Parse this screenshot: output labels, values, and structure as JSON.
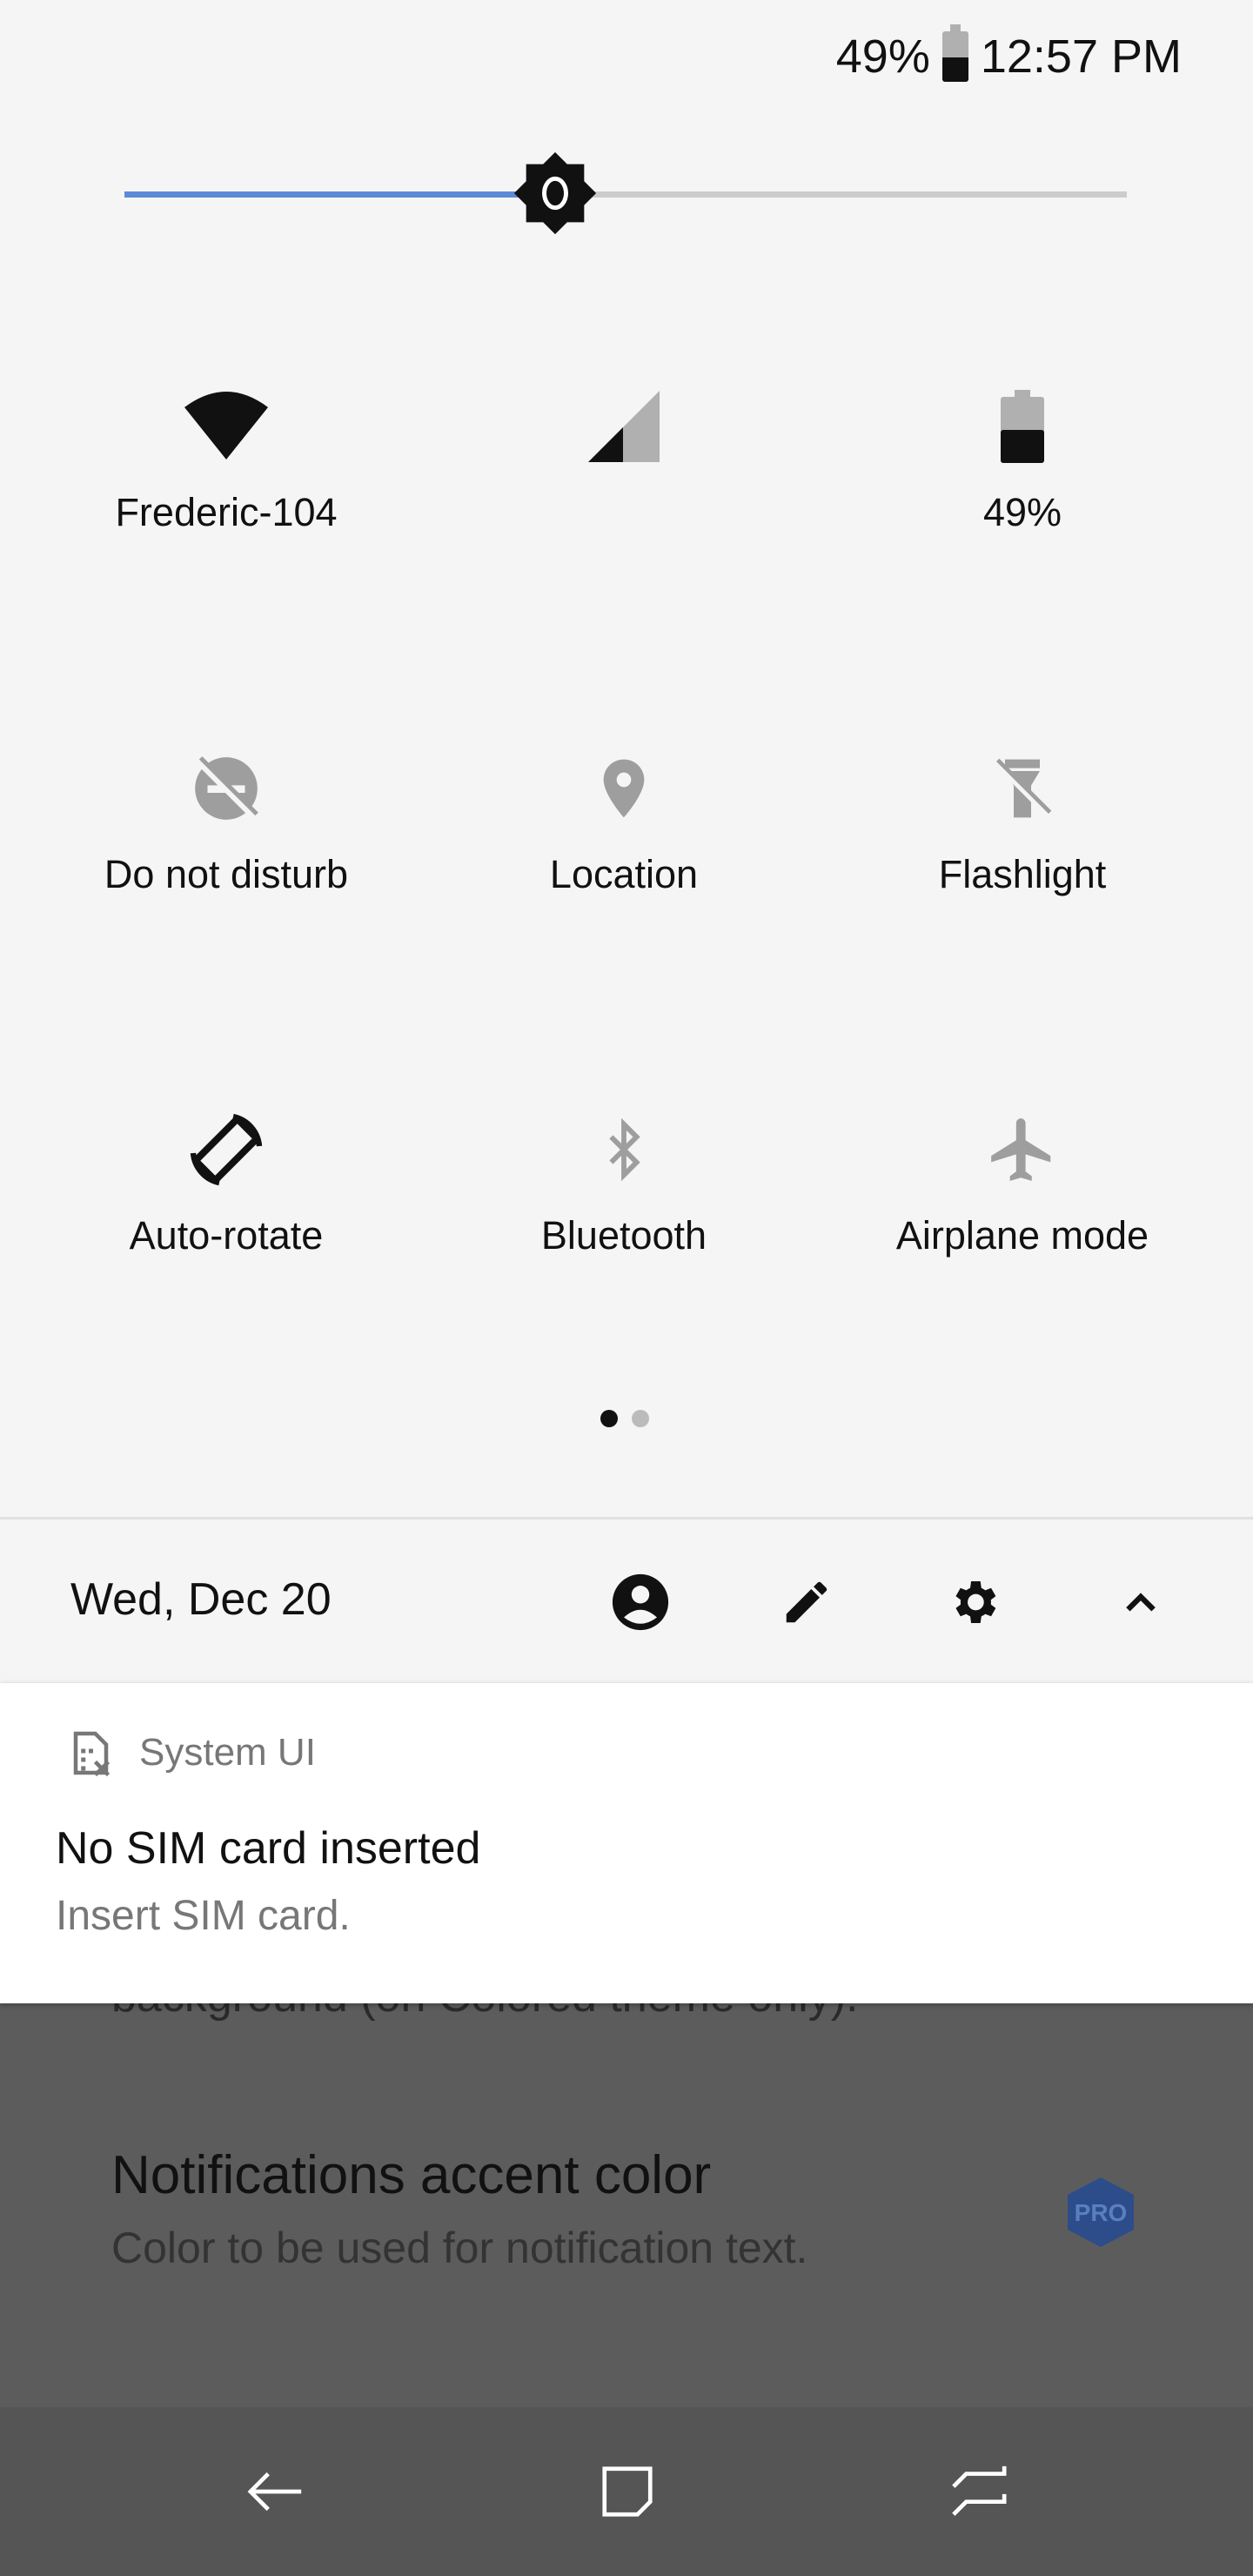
{
  "status_bar": {
    "battery_percent": "49%",
    "time": "12:57 PM",
    "battery_level": 49
  },
  "brightness": {
    "level_fraction": 0.43,
    "accent_color": "#5b8bd6"
  },
  "tiles": [
    {
      "label": "Frederic-104",
      "icon": "wifi-icon",
      "active": true
    },
    {
      "label": "",
      "icon": "cell-signal-icon",
      "active": true
    },
    {
      "label": "49%",
      "icon": "battery-icon",
      "active": true
    },
    {
      "label": "Do not disturb",
      "icon": "do-not-disturb-icon",
      "active": false
    },
    {
      "label": "Location",
      "icon": "location-icon",
      "active": false
    },
    {
      "label": "Flashlight",
      "icon": "flashlight-off-icon",
      "active": false
    },
    {
      "label": "Auto-rotate",
      "icon": "auto-rotate-icon",
      "active": true
    },
    {
      "label": "Bluetooth",
      "icon": "bluetooth-icon",
      "active": false
    },
    {
      "label": "Airplane mode",
      "icon": "airplane-icon",
      "active": false
    }
  ],
  "pager": {
    "pages": 2,
    "current": 1
  },
  "date_bar": {
    "date": "Wed, Dec 20",
    "icons": [
      "user-icon",
      "edit-icon",
      "settings-icon",
      "chevron-up-icon"
    ]
  },
  "notification": {
    "app": "System UI",
    "title": "No SIM card inserted",
    "text": "Insert SIM card.",
    "icon": "no-sim-icon"
  },
  "background_app": {
    "clipped_text": "background (on Colored theme only).",
    "setting_title": "Notifications accent color",
    "setting_subtitle": "Color to be used for notification text.",
    "badge": "PRO",
    "badge_color": "#2c4d8a"
  },
  "nav_bar": {
    "icons": [
      "back-icon",
      "home-icon",
      "recents-icon"
    ]
  }
}
